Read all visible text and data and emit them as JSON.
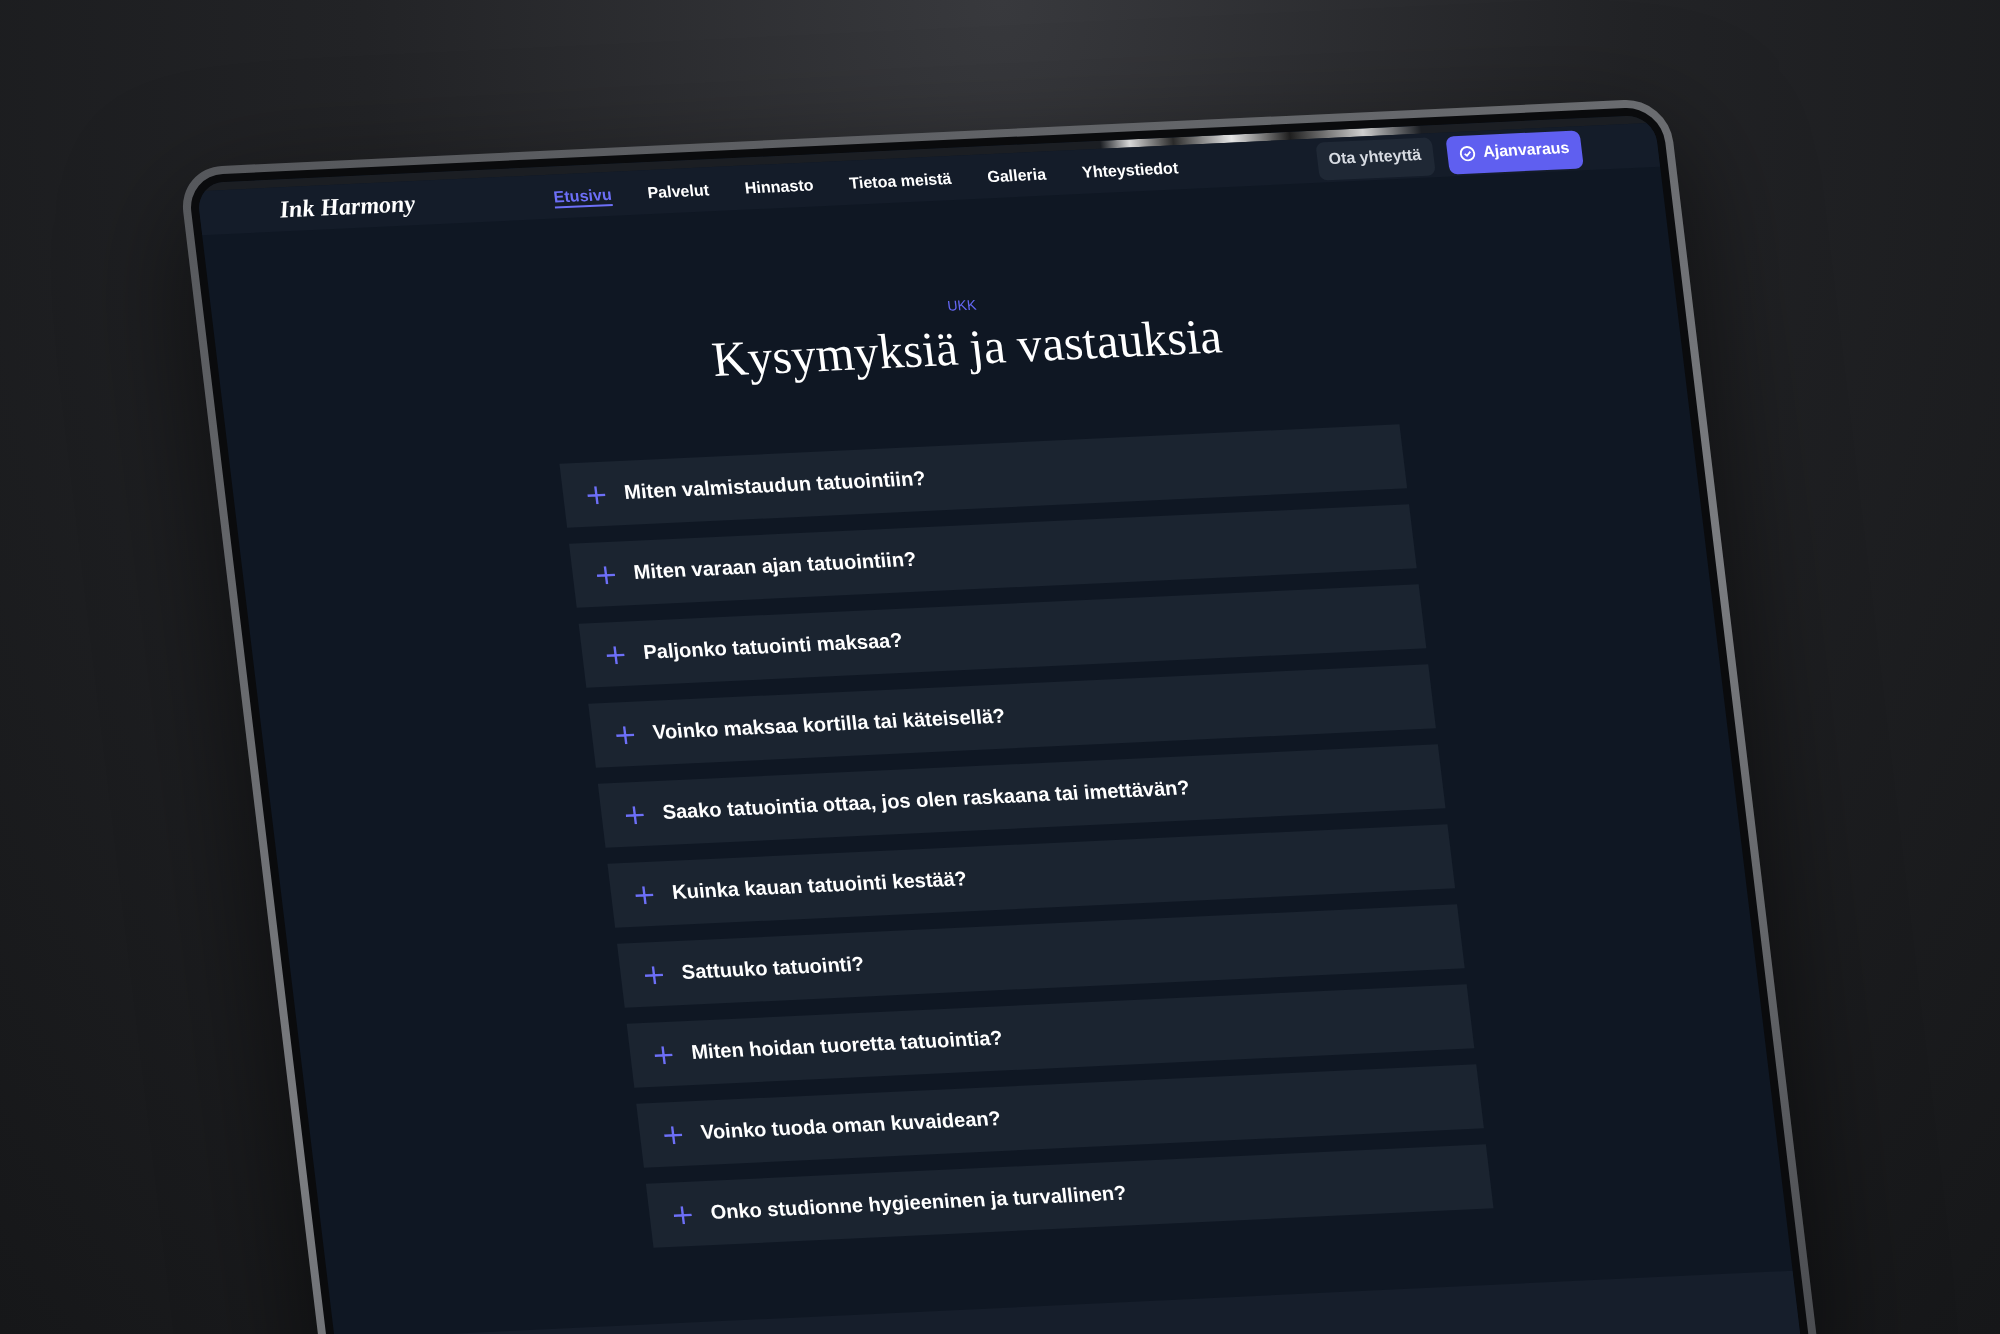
{
  "logo": {
    "text": "Ink Harmony"
  },
  "nav": {
    "links": [
      {
        "label": "Etusivu",
        "selected": true
      },
      {
        "label": "Palvelut",
        "selected": false
      },
      {
        "label": "Hinnasto",
        "selected": false
      },
      {
        "label": "Tietoa meistä",
        "selected": false
      },
      {
        "label": "Galleria",
        "selected": false
      },
      {
        "label": "Yhteystiedot",
        "selected": false
      }
    ]
  },
  "actions": [
    {
      "label": "Ota yhteyttä",
      "kind": "secondary"
    },
    {
      "label": "Ajanvaraus",
      "kind": "primary"
    }
  ],
  "faq": {
    "eyebrow": "UKK",
    "title": "Kysymyksiä ja vastauksia",
    "items": [
      {
        "question": "Miten valmistaudun tatuointiin?",
        "expanded": false
      },
      {
        "question": "Miten varaan ajan tatuointiin?",
        "expanded": false
      },
      {
        "question": "Paljonko tatuointi maksaa?",
        "expanded": false
      },
      {
        "question": "Voinko maksaa kortilla tai käteisellä?",
        "expanded": false
      },
      {
        "question": "Saako tatuointia ottaa, jos olen raskaana tai imettävän?",
        "expanded": false
      },
      {
        "question": "Kuinka kauan tatuointi kestää?",
        "expanded": false
      },
      {
        "question": "Sattuuko tatuointi?",
        "expanded": false
      },
      {
        "question": "Miten hoidan tuoretta tatuointia?",
        "expanded": false
      },
      {
        "question": "Voinko tuoda oman kuvaidean?",
        "expanded": false
      },
      {
        "question": "Onko studionne hygieeninen ja turvallinen?",
        "expanded": false
      }
    ]
  }
}
